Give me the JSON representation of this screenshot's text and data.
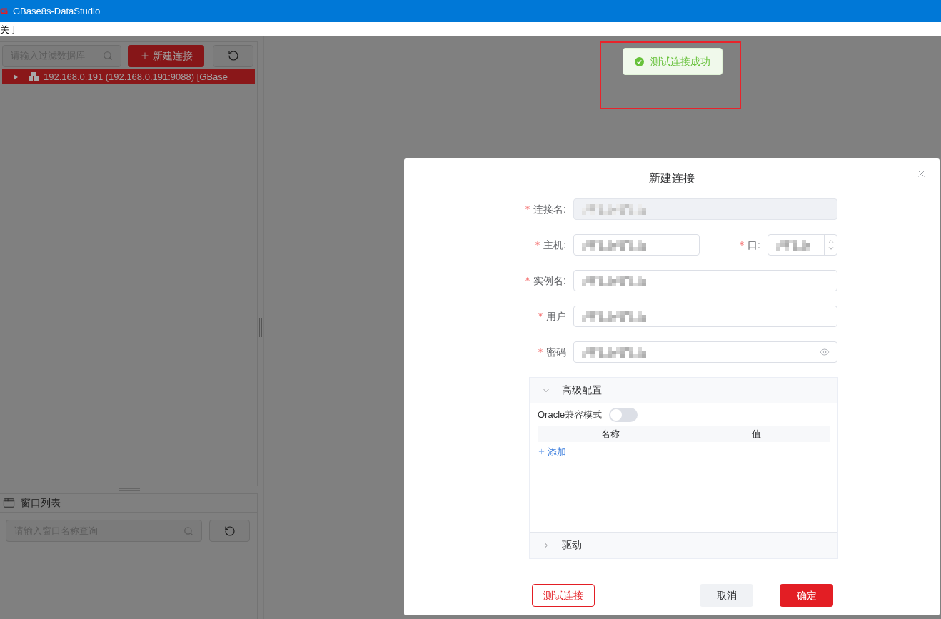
{
  "window": {
    "title": "GBase8s-DataStudio"
  },
  "menu_bar": {
    "items": [
      "关于"
    ]
  },
  "connections_panel": {
    "search": {
      "placeholder": "请输入过滤数据库"
    },
    "new_button": "新建连接",
    "tree": [
      {
        "label": "192.168.0.191 (192.168.0.191:9088) [GBase",
        "expanded": false,
        "selected": true
      }
    ]
  },
  "window_list_panel": {
    "title": "窗口列表",
    "search": {
      "placeholder": "请输入窗口名称查询"
    }
  },
  "toast": {
    "kind": "success",
    "message": "测试连接成功",
    "highlighted": true
  },
  "dialog": {
    "title": "新建连接",
    "rows": [
      [
        {
          "label": "连接名:",
          "kind": "text",
          "required": true,
          "disabled": true,
          "value_redacted": true
        }
      ],
      [
        {
          "label": "主机:",
          "kind": "text",
          "required": true,
          "disabled": false,
          "value_redacted": true
        },
        {
          "label": "口:",
          "kind": "number",
          "required": true,
          "disabled": false,
          "value_redacted": true
        }
      ],
      [
        {
          "label": "实例名:",
          "kind": "text",
          "required": true,
          "disabled": false,
          "value_redacted": true
        }
      ],
      [
        {
          "label": "用户",
          "kind": "text",
          "required": true,
          "disabled": false,
          "value_redacted": true
        }
      ],
      [
        {
          "label": "密码",
          "kind": "password",
          "required": true,
          "disabled": false,
          "value_redacted": true
        }
      ]
    ],
    "sections": [
      {
        "title": "高级配置",
        "expanded": true,
        "switch": {
          "label": "Oracle兼容模式",
          "on": false
        },
        "table": {
          "columns": [
            "名称",
            "值"
          ]
        },
        "add_link": "添加"
      },
      {
        "title": "驱动",
        "expanded": false
      }
    ],
    "buttons": [
      {
        "label": "测试连接",
        "kind": "outline"
      },
      {
        "label": "取消",
        "kind": "secondary"
      },
      {
        "label": "确定",
        "kind": "primary"
      }
    ]
  }
}
